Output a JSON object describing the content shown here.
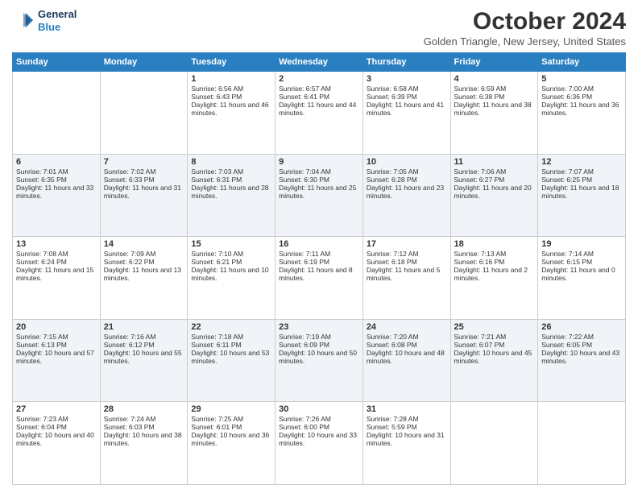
{
  "header": {
    "logo_line1": "General",
    "logo_line2": "Blue",
    "month_title": "October 2024",
    "location": "Golden Triangle, New Jersey, United States"
  },
  "days_of_week": [
    "Sunday",
    "Monday",
    "Tuesday",
    "Wednesday",
    "Thursday",
    "Friday",
    "Saturday"
  ],
  "weeks": [
    [
      {
        "day": "",
        "sunrise": "",
        "sunset": "",
        "daylight": ""
      },
      {
        "day": "",
        "sunrise": "",
        "sunset": "",
        "daylight": ""
      },
      {
        "day": "1",
        "sunrise": "Sunrise: 6:56 AM",
        "sunset": "Sunset: 6:43 PM",
        "daylight": "Daylight: 11 hours and 46 minutes."
      },
      {
        "day": "2",
        "sunrise": "Sunrise: 6:57 AM",
        "sunset": "Sunset: 6:41 PM",
        "daylight": "Daylight: 11 hours and 44 minutes."
      },
      {
        "day": "3",
        "sunrise": "Sunrise: 6:58 AM",
        "sunset": "Sunset: 6:39 PM",
        "daylight": "Daylight: 11 hours and 41 minutes."
      },
      {
        "day": "4",
        "sunrise": "Sunrise: 6:59 AM",
        "sunset": "Sunset: 6:38 PM",
        "daylight": "Daylight: 11 hours and 38 minutes."
      },
      {
        "day": "5",
        "sunrise": "Sunrise: 7:00 AM",
        "sunset": "Sunset: 6:36 PM",
        "daylight": "Daylight: 11 hours and 36 minutes."
      }
    ],
    [
      {
        "day": "6",
        "sunrise": "Sunrise: 7:01 AM",
        "sunset": "Sunset: 6:35 PM",
        "daylight": "Daylight: 11 hours and 33 minutes."
      },
      {
        "day": "7",
        "sunrise": "Sunrise: 7:02 AM",
        "sunset": "Sunset: 6:33 PM",
        "daylight": "Daylight: 11 hours and 31 minutes."
      },
      {
        "day": "8",
        "sunrise": "Sunrise: 7:03 AM",
        "sunset": "Sunset: 6:31 PM",
        "daylight": "Daylight: 11 hours and 28 minutes."
      },
      {
        "day": "9",
        "sunrise": "Sunrise: 7:04 AM",
        "sunset": "Sunset: 6:30 PM",
        "daylight": "Daylight: 11 hours and 25 minutes."
      },
      {
        "day": "10",
        "sunrise": "Sunrise: 7:05 AM",
        "sunset": "Sunset: 6:28 PM",
        "daylight": "Daylight: 11 hours and 23 minutes."
      },
      {
        "day": "11",
        "sunrise": "Sunrise: 7:06 AM",
        "sunset": "Sunset: 6:27 PM",
        "daylight": "Daylight: 11 hours and 20 minutes."
      },
      {
        "day": "12",
        "sunrise": "Sunrise: 7:07 AM",
        "sunset": "Sunset: 6:25 PM",
        "daylight": "Daylight: 11 hours and 18 minutes."
      }
    ],
    [
      {
        "day": "13",
        "sunrise": "Sunrise: 7:08 AM",
        "sunset": "Sunset: 6:24 PM",
        "daylight": "Daylight: 11 hours and 15 minutes."
      },
      {
        "day": "14",
        "sunrise": "Sunrise: 7:09 AM",
        "sunset": "Sunset: 6:22 PM",
        "daylight": "Daylight: 11 hours and 13 minutes."
      },
      {
        "day": "15",
        "sunrise": "Sunrise: 7:10 AM",
        "sunset": "Sunset: 6:21 PM",
        "daylight": "Daylight: 11 hours and 10 minutes."
      },
      {
        "day": "16",
        "sunrise": "Sunrise: 7:11 AM",
        "sunset": "Sunset: 6:19 PM",
        "daylight": "Daylight: 11 hours and 8 minutes."
      },
      {
        "day": "17",
        "sunrise": "Sunrise: 7:12 AM",
        "sunset": "Sunset: 6:18 PM",
        "daylight": "Daylight: 11 hours and 5 minutes."
      },
      {
        "day": "18",
        "sunrise": "Sunrise: 7:13 AM",
        "sunset": "Sunset: 6:16 PM",
        "daylight": "Daylight: 11 hours and 2 minutes."
      },
      {
        "day": "19",
        "sunrise": "Sunrise: 7:14 AM",
        "sunset": "Sunset: 6:15 PM",
        "daylight": "Daylight: 11 hours and 0 minutes."
      }
    ],
    [
      {
        "day": "20",
        "sunrise": "Sunrise: 7:15 AM",
        "sunset": "Sunset: 6:13 PM",
        "daylight": "Daylight: 10 hours and 57 minutes."
      },
      {
        "day": "21",
        "sunrise": "Sunrise: 7:16 AM",
        "sunset": "Sunset: 6:12 PM",
        "daylight": "Daylight: 10 hours and 55 minutes."
      },
      {
        "day": "22",
        "sunrise": "Sunrise: 7:18 AM",
        "sunset": "Sunset: 6:11 PM",
        "daylight": "Daylight: 10 hours and 53 minutes."
      },
      {
        "day": "23",
        "sunrise": "Sunrise: 7:19 AM",
        "sunset": "Sunset: 6:09 PM",
        "daylight": "Daylight: 10 hours and 50 minutes."
      },
      {
        "day": "24",
        "sunrise": "Sunrise: 7:20 AM",
        "sunset": "Sunset: 6:08 PM",
        "daylight": "Daylight: 10 hours and 48 minutes."
      },
      {
        "day": "25",
        "sunrise": "Sunrise: 7:21 AM",
        "sunset": "Sunset: 6:07 PM",
        "daylight": "Daylight: 10 hours and 45 minutes."
      },
      {
        "day": "26",
        "sunrise": "Sunrise: 7:22 AM",
        "sunset": "Sunset: 6:05 PM",
        "daylight": "Daylight: 10 hours and 43 minutes."
      }
    ],
    [
      {
        "day": "27",
        "sunrise": "Sunrise: 7:23 AM",
        "sunset": "Sunset: 6:04 PM",
        "daylight": "Daylight: 10 hours and 40 minutes."
      },
      {
        "day": "28",
        "sunrise": "Sunrise: 7:24 AM",
        "sunset": "Sunset: 6:03 PM",
        "daylight": "Daylight: 10 hours and 38 minutes."
      },
      {
        "day": "29",
        "sunrise": "Sunrise: 7:25 AM",
        "sunset": "Sunset: 6:01 PM",
        "daylight": "Daylight: 10 hours and 36 minutes."
      },
      {
        "day": "30",
        "sunrise": "Sunrise: 7:26 AM",
        "sunset": "Sunset: 6:00 PM",
        "daylight": "Daylight: 10 hours and 33 minutes."
      },
      {
        "day": "31",
        "sunrise": "Sunrise: 7:28 AM",
        "sunset": "Sunset: 5:59 PM",
        "daylight": "Daylight: 10 hours and 31 minutes."
      },
      {
        "day": "",
        "sunrise": "",
        "sunset": "",
        "daylight": ""
      },
      {
        "day": "",
        "sunrise": "",
        "sunset": "",
        "daylight": ""
      }
    ]
  ]
}
